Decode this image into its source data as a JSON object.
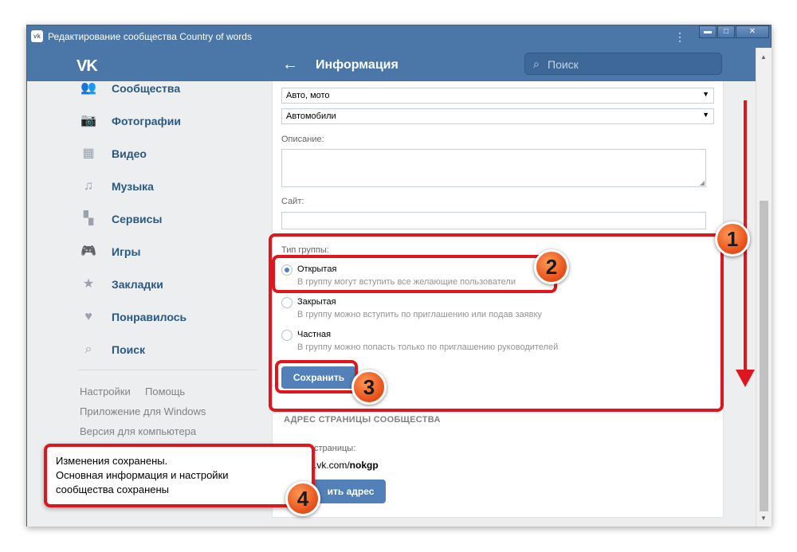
{
  "window": {
    "title": "Редактирование сообщества Country of words",
    "app_icon": "vk-icon",
    "kebab": "⋮",
    "minimize": "▬",
    "maximize": "□",
    "close": "✕"
  },
  "header": {
    "logo": "VK",
    "back": "←",
    "title": "Информация",
    "search_placeholder": "Поиск"
  },
  "sidebar": {
    "items": [
      {
        "label": "Сообщества",
        "icon": "communities-icon"
      },
      {
        "label": "Фотографии",
        "icon": "camera-icon"
      },
      {
        "label": "Видео",
        "icon": "video-icon"
      },
      {
        "label": "Музыка",
        "icon": "music-icon"
      },
      {
        "label": "Сервисы",
        "icon": "services-icon"
      },
      {
        "label": "Игры",
        "icon": "gamepad-icon"
      },
      {
        "label": "Закладки",
        "icon": "star-icon"
      },
      {
        "label": "Понравилось",
        "icon": "heart-icon"
      },
      {
        "label": "Поиск",
        "icon": "search-icon"
      }
    ],
    "footer": {
      "settings": "Настройки",
      "help": "Помощь",
      "windows_app": "Приложение для Windows",
      "desktop_version": "Версия для компьютера"
    }
  },
  "form": {
    "category": "Авто, мото",
    "subcategory": "Автомобили",
    "description_label": "Описание:",
    "site_label": "Сайт:",
    "group_type_label": "Тип группы:",
    "options": [
      {
        "title": "Открытая",
        "desc": "В группу могут вступить все желающие пользователи",
        "checked": true
      },
      {
        "title": "Закрытая",
        "desc": "В группу можно вступить по приглашению или подав заявку",
        "checked": false
      },
      {
        "title": "Частная",
        "desc": "В группу можно попасть только по приглашению руководителей",
        "checked": false
      }
    ],
    "save": "Сохранить"
  },
  "address": {
    "section_title": "АДРЕС СТРАНИЦЫ СООБЩЕСТВА",
    "label_partial": "страницы:",
    "url_prefix": ".vk.com/",
    "url_slug": "nokgp",
    "button_partial": "ить адрес"
  },
  "toast": {
    "line1": "Изменения сохранены.",
    "line2": "Основная информация и настройки",
    "line3": "сообщества сохранены"
  },
  "annotations": {
    "badge1": "1",
    "badge2": "2",
    "badge3": "3",
    "badge4": "4",
    "highlight_color": "#e0161e",
    "badge_color": "#e8521b"
  },
  "colors": {
    "brand": "#4a76a8",
    "button": "#5181b8",
    "link": "#2a5885"
  }
}
